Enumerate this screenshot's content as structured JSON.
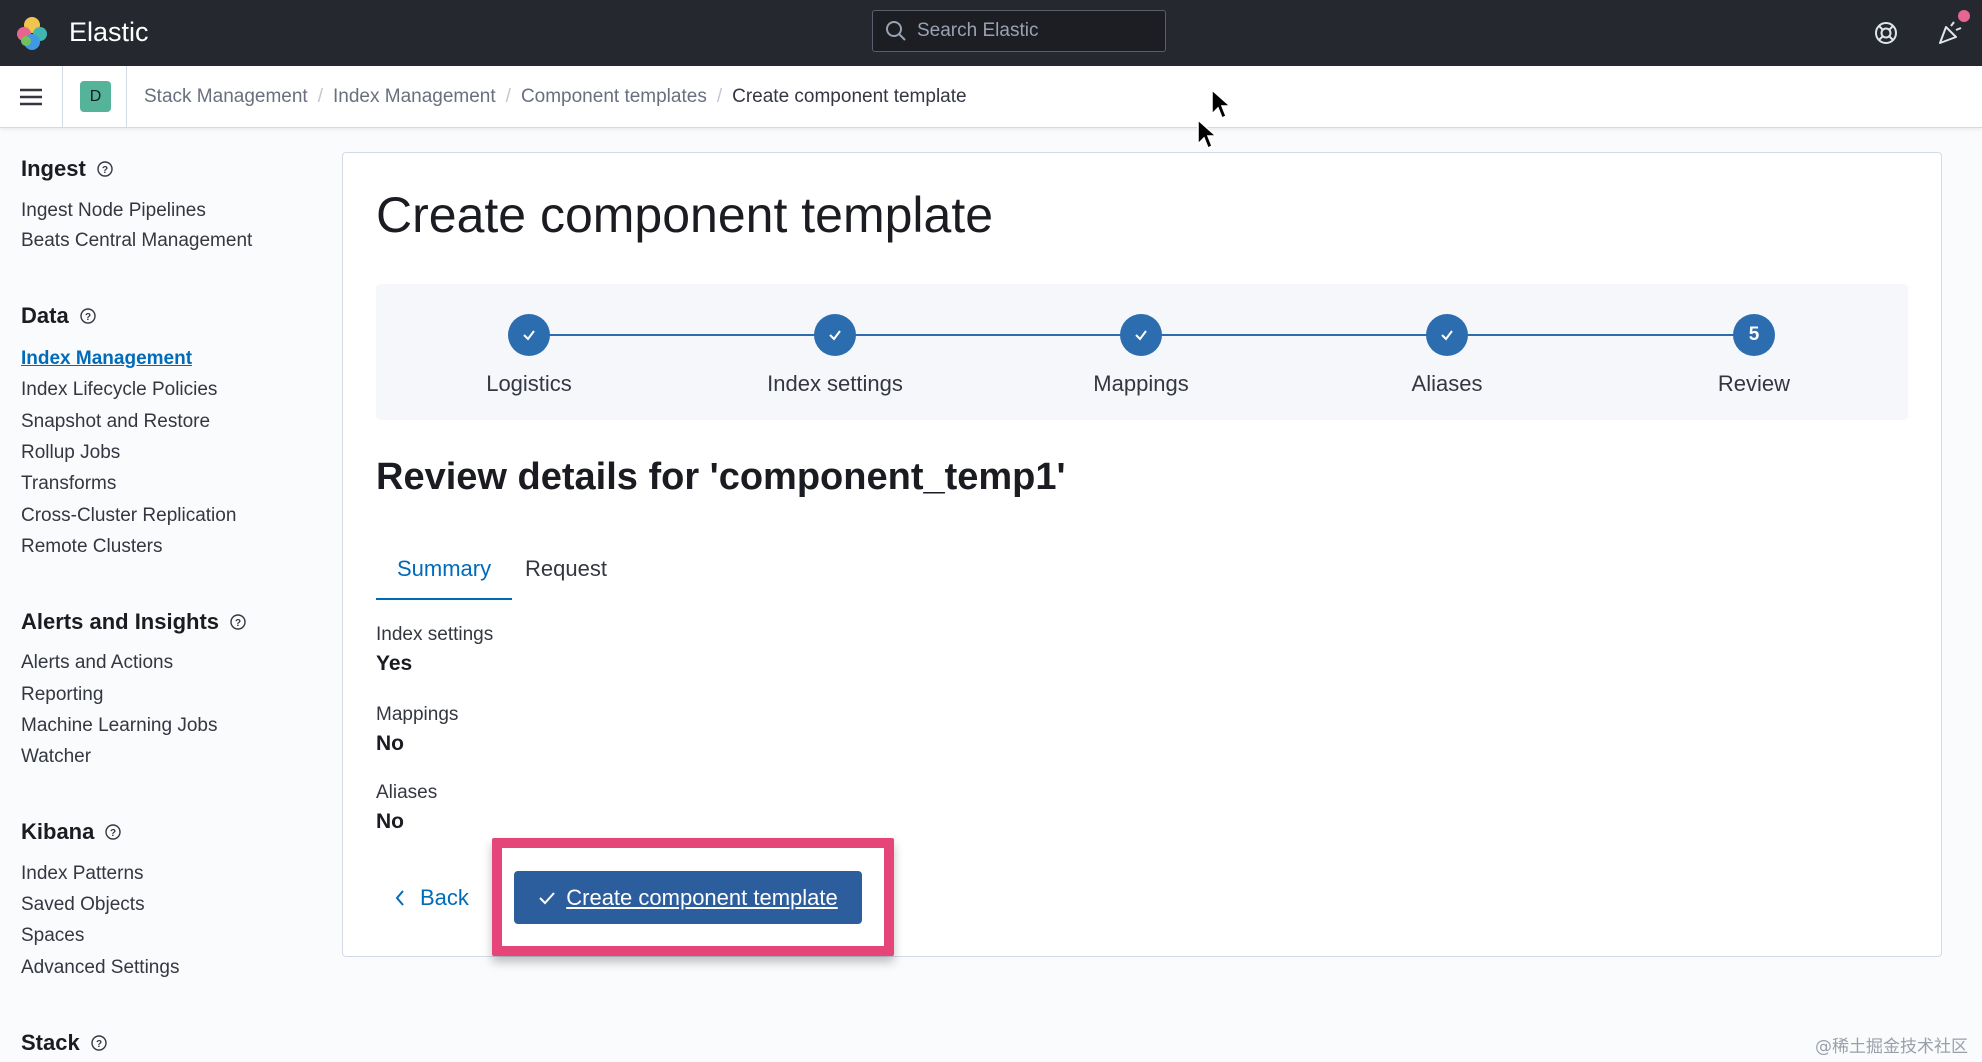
{
  "header": {
    "brand": "Elastic",
    "search_placeholder": "Search Elastic",
    "icons": [
      "elastic-logo",
      "search-icon",
      "help-icon",
      "newsfeed-icon"
    ],
    "notification_color": "#e7668f"
  },
  "breadcrumb": {
    "space_initial": "D",
    "items": [
      "Stack Management",
      "Index Management",
      "Component templates"
    ],
    "current": "Create component template"
  },
  "sidebar": {
    "sections": [
      {
        "title": "Ingest",
        "items": [
          "Ingest Node Pipelines",
          "Beats Central Management"
        ]
      },
      {
        "title": "Data",
        "items": [
          "Index Management",
          "Index Lifecycle Policies",
          "Snapshot and Restore",
          "Rollup Jobs",
          "Transforms",
          "Cross-Cluster Replication",
          "Remote Clusters"
        ],
        "active": "Index Management"
      },
      {
        "title": "Alerts and Insights",
        "items": [
          "Alerts and Actions",
          "Reporting",
          "Machine Learning Jobs",
          "Watcher"
        ]
      },
      {
        "title": "Kibana",
        "items": [
          "Index Patterns",
          "Saved Objects",
          "Spaces",
          "Advanced Settings"
        ]
      },
      {
        "title": "Stack",
        "items": []
      }
    ]
  },
  "main": {
    "title": "Create component template",
    "steps": [
      {
        "label": "Logistics",
        "status": "complete"
      },
      {
        "label": "Index settings",
        "status": "complete"
      },
      {
        "label": "Mappings",
        "status": "complete"
      },
      {
        "label": "Aliases",
        "status": "complete"
      },
      {
        "label": "Review",
        "status": "current",
        "number": "5"
      }
    ],
    "review_title": "Review details for 'component_temp1'",
    "tabs": [
      "Summary",
      "Request"
    ],
    "selected_tab": "Summary",
    "summary": [
      {
        "term": "Index settings",
        "value": "Yes"
      },
      {
        "term": "Mappings",
        "value": "No"
      },
      {
        "term": "Aliases",
        "value": "No"
      }
    ],
    "back_label": "Back",
    "create_label": "Create component template"
  },
  "accent_color": "#006bb8",
  "highlight_color": "#e6457a",
  "watermark": "@稀土掘金技术社区"
}
